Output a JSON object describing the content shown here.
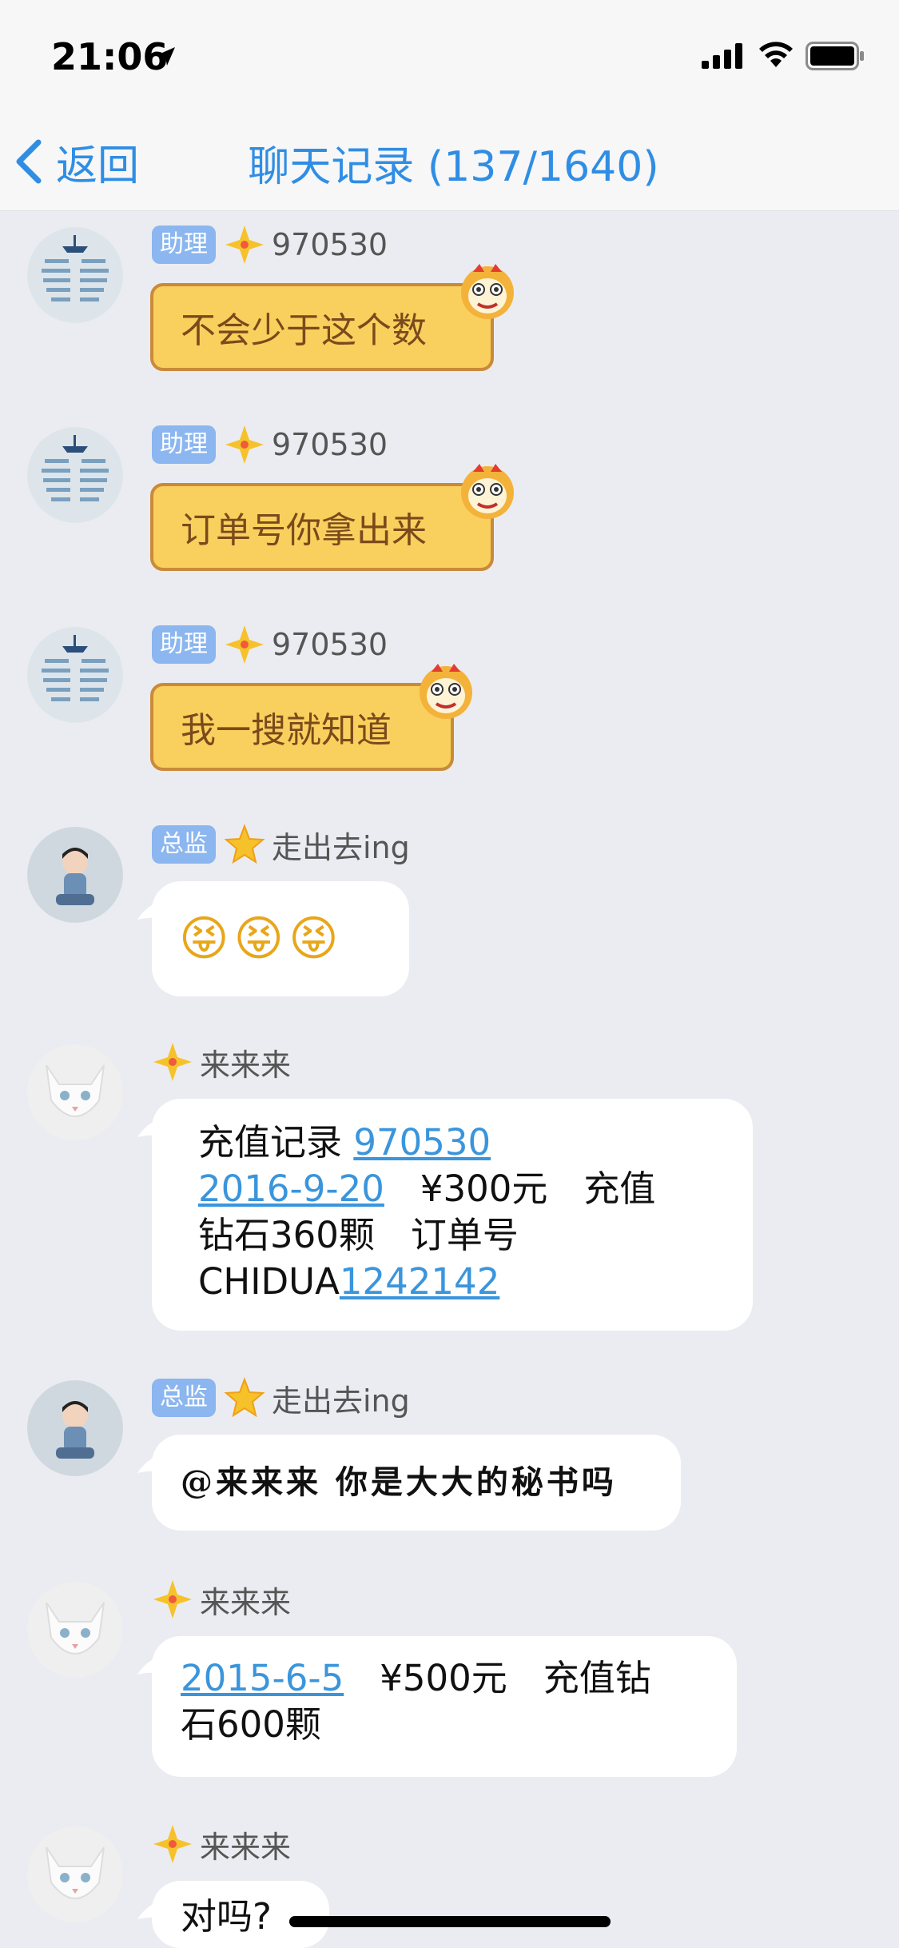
{
  "status_bar": {
    "time": "21:06"
  },
  "nav": {
    "back_label": "返回",
    "title": "聊天记录 (137/1640)"
  },
  "messages": [
    {
      "role": "助理",
      "sender": "970530",
      "text": "不会少于这个数"
    },
    {
      "role": "助理",
      "sender": "970530",
      "text": "订单号你拿出来"
    },
    {
      "role": "助理",
      "sender": "970530",
      "text": "我一搜就知道"
    },
    {
      "role": "总监",
      "sender": "走出去ing",
      "text": "😝😝😝"
    },
    {
      "sender": "来来来",
      "parts": [
        "充值记录 ",
        "970530",
        "2016-9-20",
        "　¥300元　充值",
        "钻石360颗　订单号",
        "CHIDUA",
        "1242142"
      ]
    },
    {
      "role": "总监",
      "sender": "走出去ing",
      "text": "@来来来 你是大大的秘书吗"
    },
    {
      "sender": "来来来",
      "parts": [
        "2015-6-5",
        "　¥500元　充值钻",
        "石600颗"
      ]
    },
    {
      "sender": "来来来",
      "text": "对吗?"
    }
  ],
  "colors": {
    "accent": "#2f8ee4",
    "bubble_yellow": "#f9d05d",
    "badge": "#8bb6ef",
    "link": "#3a95dc",
    "background": "#ebecf1"
  },
  "icons": [
    "location-arrow-icon",
    "signal-icon",
    "wifi-icon",
    "battery-icon",
    "back-chevron-icon",
    "level-diamond-icon",
    "lion-head-icon"
  ]
}
